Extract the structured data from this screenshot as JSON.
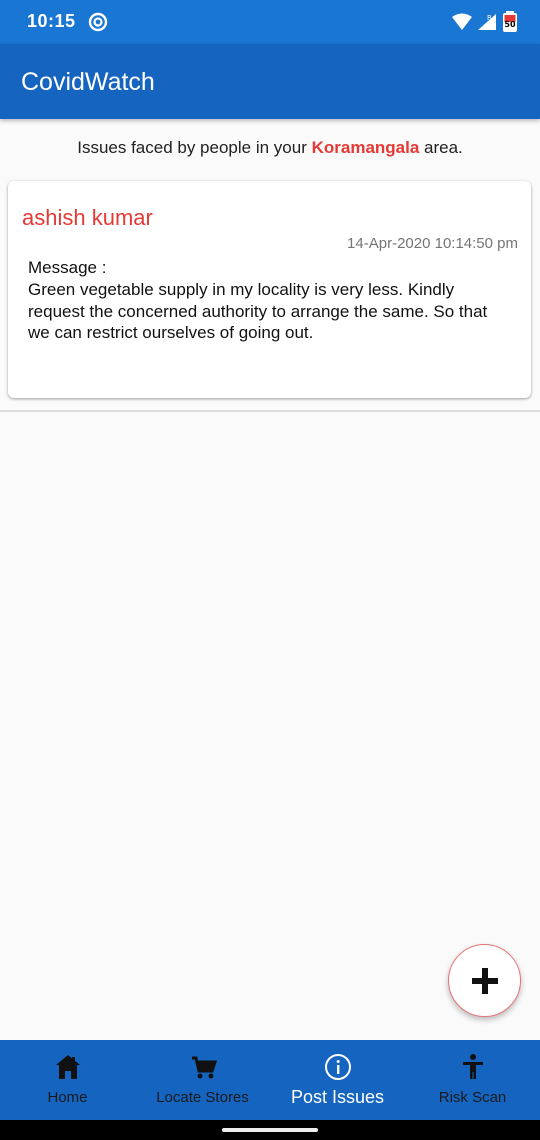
{
  "status_bar": {
    "time": "10:15",
    "battery": "50"
  },
  "app_bar": {
    "title": "CovidWatch"
  },
  "subheader": {
    "prefix": "Issues faced by people in your ",
    "area": "Koramangala",
    "suffix": " area."
  },
  "issues": [
    {
      "author": "ashish kumar",
      "timestamp": "14-Apr-2020 10:14:50 pm",
      "message_label": "Message :",
      "message": "Green vegetable supply in my locality is very less. Kindly request the concerned authority to arrange the same. So that we can restrict ourselves of going out."
    }
  ],
  "fab": {
    "icon": "add-icon"
  },
  "bottom_nav": {
    "items": [
      {
        "label": "Home",
        "icon": "home-icon",
        "active": false
      },
      {
        "label": "Locate Stores",
        "icon": "cart-icon",
        "active": false
      },
      {
        "label": "Post Issues",
        "icon": "info-icon",
        "active": true
      },
      {
        "label": "Risk Scan",
        "icon": "accessibility-icon",
        "active": false
      }
    ]
  },
  "colors": {
    "primary": "#1565c0",
    "status_bar": "#1976d2",
    "accent_red": "#e53935"
  }
}
